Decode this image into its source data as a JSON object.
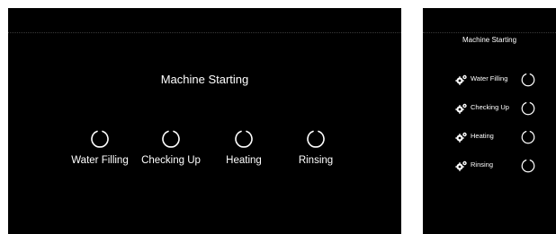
{
  "wide_panel": {
    "title": "Machine Starting",
    "stages": [
      {
        "label": "Water Filling",
        "icon": "spinner-icon"
      },
      {
        "label": "Checking Up",
        "icon": "spinner-icon"
      },
      {
        "label": "Heating",
        "icon": "spinner-icon"
      },
      {
        "label": "Rinsing",
        "icon": "spinner-icon"
      }
    ]
  },
  "narrow_panel": {
    "title": "Machine Starting",
    "stages": [
      {
        "label": "Water Filling",
        "icon": "gears-icon",
        "status_icon": "spinner-icon"
      },
      {
        "label": "Checking Up",
        "icon": "gears-icon",
        "status_icon": "spinner-icon"
      },
      {
        "label": "Heating",
        "icon": "gears-icon",
        "status_icon": "spinner-icon"
      },
      {
        "label": "Rinsing",
        "icon": "gears-icon",
        "status_icon": "spinner-icon"
      }
    ]
  },
  "colors": {
    "background": "#000000",
    "text": "#ffffff",
    "frame": "#ffffff"
  }
}
